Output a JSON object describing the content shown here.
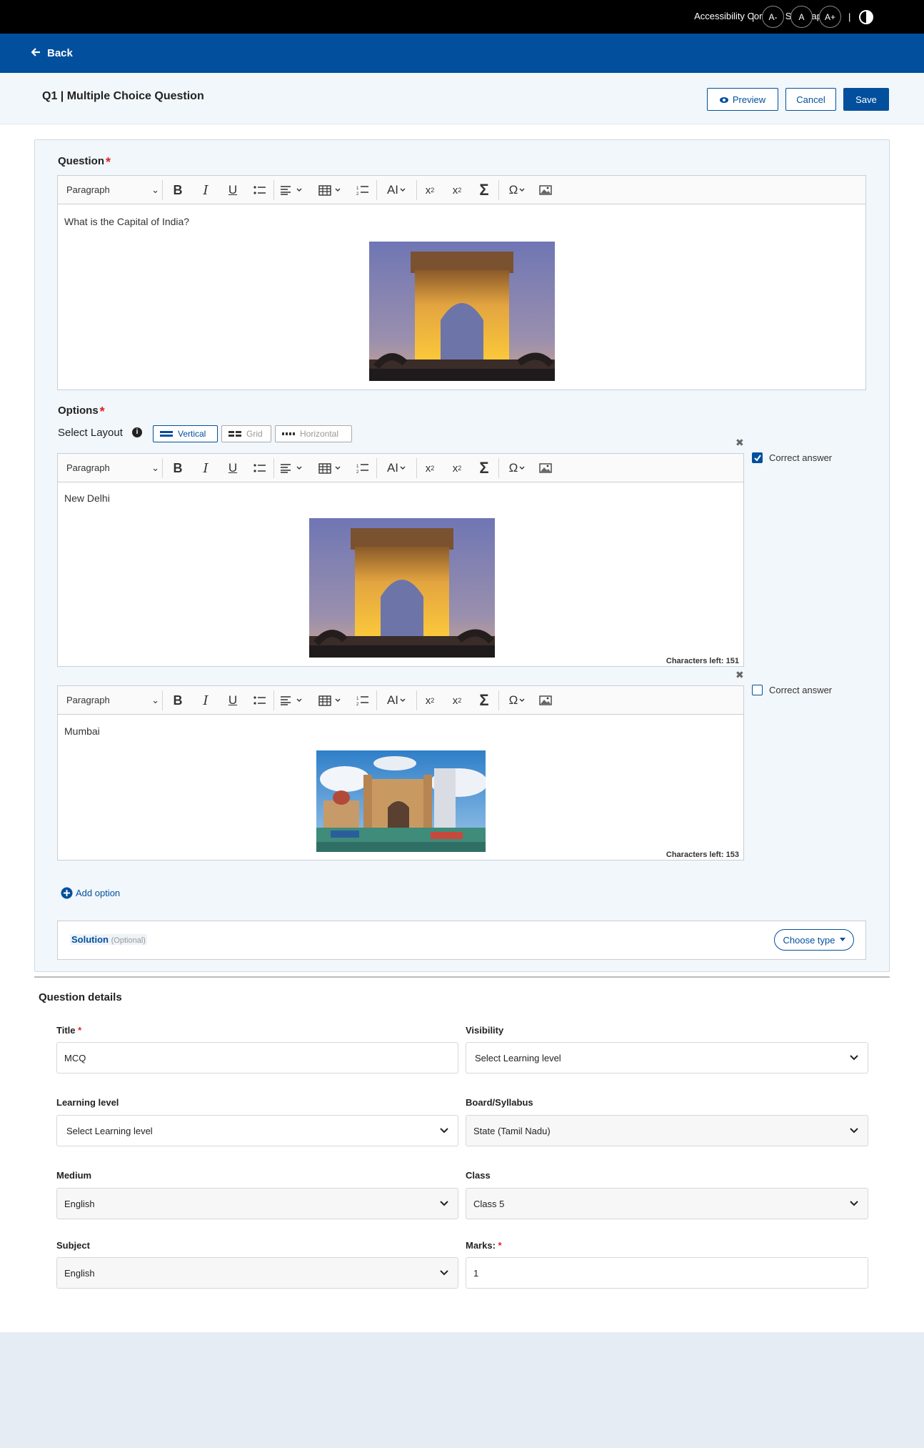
{
  "topbar": {
    "accessibility": "Accessibility Corner",
    "sitemap": "Site Map",
    "font_minus": "A-",
    "font_normal": "A",
    "font_plus": "A+"
  },
  "nav": {
    "back": "Back"
  },
  "header": {
    "title": "Q1 | Multiple Choice Question",
    "preview": "Preview",
    "cancel": "Cancel",
    "save": "Save"
  },
  "editor_toolbar": {
    "paragraph": "Paragraph"
  },
  "question": {
    "label": "Question",
    "text": "What is the Capital of India?"
  },
  "options": {
    "label": "Options",
    "select_layout": "Select Layout",
    "layouts": [
      "Vertical",
      "Grid",
      "Horizontal"
    ],
    "items": [
      {
        "text": "New Delhi",
        "correct_label": "Correct answer",
        "correct": true,
        "chars_left": "Characters left: 151"
      },
      {
        "text": "Mumbai",
        "correct_label": "Correct answer",
        "correct": false,
        "chars_left": "Characters left: 153"
      }
    ],
    "add_option": "Add option"
  },
  "solution": {
    "label": "Solution",
    "optional": "(Optional)",
    "choose_type": "Choose type"
  },
  "details": {
    "heading": "Question details",
    "title_label": "Title",
    "title_value": "MCQ",
    "visibility_label": "Visibility",
    "visibility_value": "Select Learning level",
    "learning_label": "Learning level",
    "learning_value": "Select Learning level",
    "board_label": "Board/Syllabus",
    "board_value": "State (Tamil Nadu)",
    "medium_label": "Medium",
    "medium_value": "English",
    "class_label": "Class",
    "class_value": "Class 5",
    "subject_label": "Subject",
    "subject_value": "English",
    "marks_label": "Marks:",
    "marks_value": "1"
  },
  "colors": {
    "primary": "#024f9d",
    "required": "#e02424",
    "panel": "#f2f7fb"
  }
}
